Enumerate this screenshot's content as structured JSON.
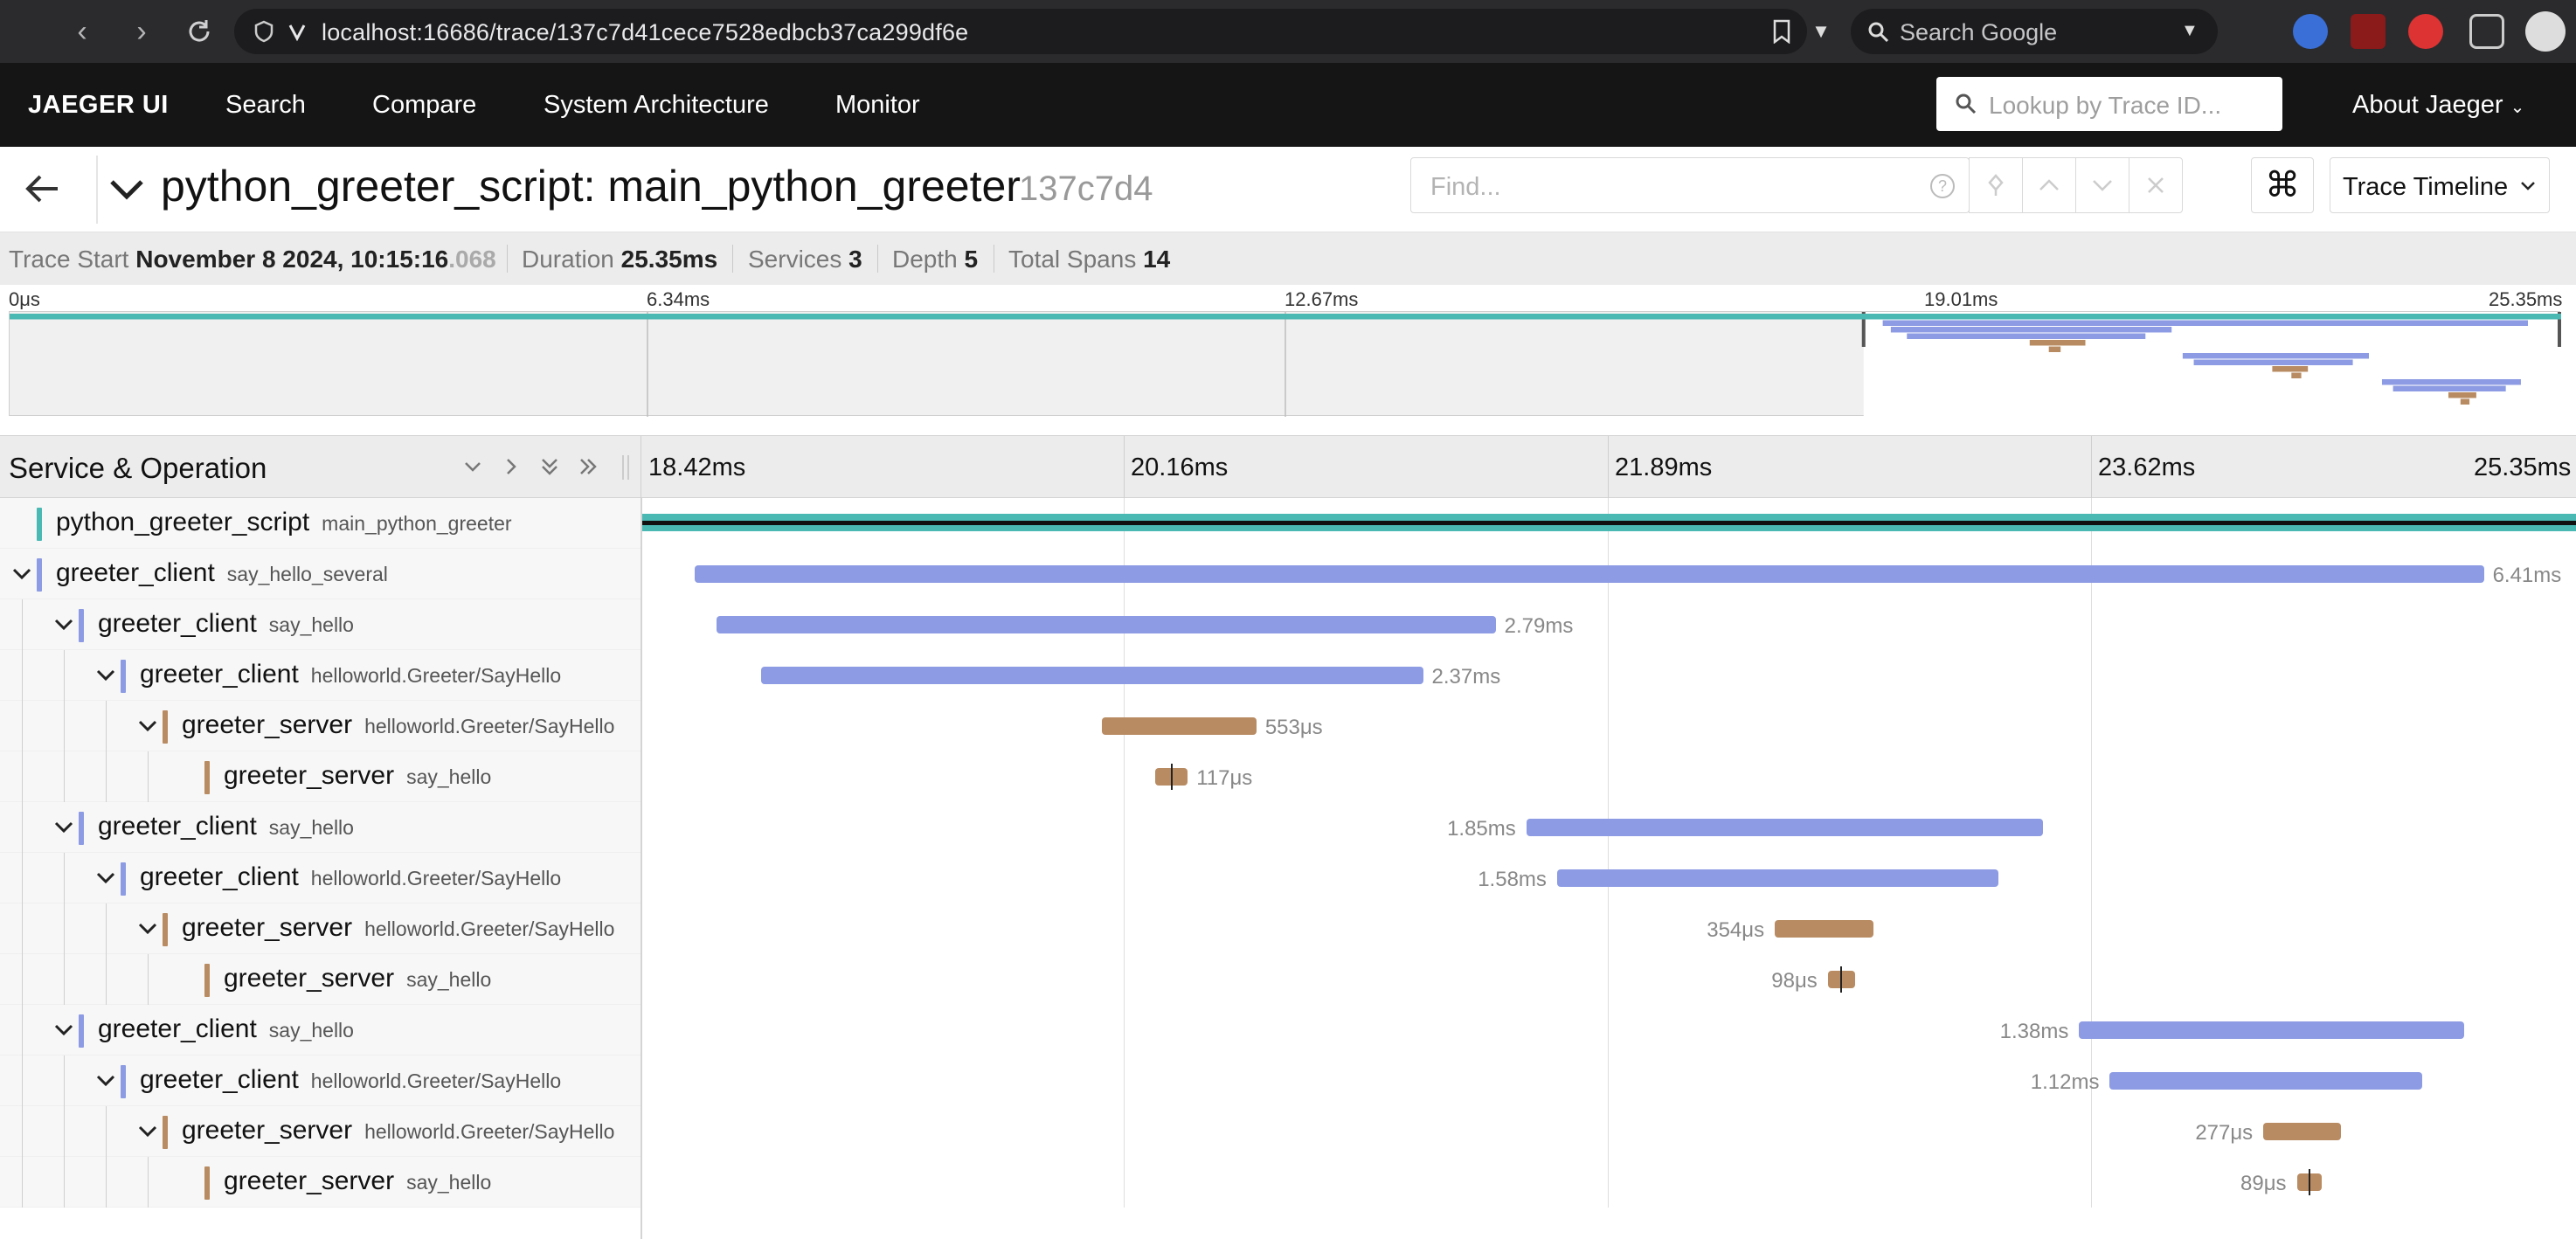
{
  "browser": {
    "url": "localhost:16686/trace/137c7d41cece7528edbcb37ca299df6e",
    "search_placeholder": "Search Google"
  },
  "topnav": {
    "brand": "JAEGER UI",
    "items": [
      "Search",
      "Compare",
      "System Architecture",
      "Monitor"
    ],
    "lookup_placeholder": "Lookup by Trace ID...",
    "about": "About Jaeger"
  },
  "trace": {
    "title": "python_greeter_script: main_python_greeter",
    "short_id": "137c7d4",
    "find_placeholder": "Find...",
    "view_mode": "Trace Timeline"
  },
  "summary": {
    "trace_start_label": "Trace Start",
    "trace_start_value": "November 8 2024, 10:15:16",
    "trace_start_ms": ".068",
    "duration_label": "Duration",
    "duration_value": "25.35ms",
    "services_label": "Services",
    "services_value": "3",
    "depth_label": "Depth",
    "depth_value": "5",
    "total_spans_label": "Total Spans",
    "total_spans_value": "14"
  },
  "minimap": {
    "ticks": [
      "0μs",
      "6.34ms",
      "12.67ms",
      "19.01ms",
      "25.35ms"
    ]
  },
  "timeline": {
    "header_title": "Service & Operation",
    "ticks": [
      "18.42ms",
      "20.16ms",
      "21.89ms",
      "23.62ms",
      "25.35ms"
    ]
  },
  "colors": {
    "python_greeter_script": "#4ab8b3",
    "greeter_client": "#8c9be3",
    "greeter_server": "#b88b62"
  },
  "spans": [
    {
      "service": "python_greeter_script",
      "operation": "main_python_greeter",
      "depth": 0,
      "has_children": false,
      "start_ms": 0.0,
      "duration_ms": 25.35,
      "label": ""
    },
    {
      "service": "greeter_client",
      "operation": "say_hello_several",
      "depth": 0,
      "has_children": true,
      "start_ms": 18.61,
      "duration_ms": 6.41,
      "label": "6.41ms"
    },
    {
      "service": "greeter_client",
      "operation": "say_hello",
      "depth": 1,
      "has_children": true,
      "start_ms": 18.69,
      "duration_ms": 2.79,
      "label": "2.79ms"
    },
    {
      "service": "greeter_client",
      "operation": "helloworld.Greeter/SayHello",
      "depth": 2,
      "has_children": true,
      "start_ms": 18.85,
      "duration_ms": 2.37,
      "label": "2.37ms"
    },
    {
      "service": "greeter_server",
      "operation": "helloworld.Greeter/SayHello",
      "depth": 3,
      "has_children": true,
      "start_ms": 20.07,
      "duration_ms": 0.553,
      "label": "553μs"
    },
    {
      "service": "greeter_server",
      "operation": "say_hello",
      "depth": 4,
      "has_children": false,
      "start_ms": 20.26,
      "duration_ms": 0.117,
      "label": "117μs"
    },
    {
      "service": "greeter_client",
      "operation": "say_hello",
      "depth": 1,
      "has_children": true,
      "start_ms": 21.59,
      "duration_ms": 1.85,
      "label": "1.85ms"
    },
    {
      "service": "greeter_client",
      "operation": "helloworld.Greeter/SayHello",
      "depth": 2,
      "has_children": true,
      "start_ms": 21.7,
      "duration_ms": 1.58,
      "label": "1.58ms"
    },
    {
      "service": "greeter_server",
      "operation": "helloworld.Greeter/SayHello",
      "depth": 3,
      "has_children": true,
      "start_ms": 22.48,
      "duration_ms": 0.354,
      "label": "354μs"
    },
    {
      "service": "greeter_server",
      "operation": "say_hello",
      "depth": 4,
      "has_children": false,
      "start_ms": 22.67,
      "duration_ms": 0.098,
      "label": "98μs"
    },
    {
      "service": "greeter_client",
      "operation": "say_hello",
      "depth": 1,
      "has_children": true,
      "start_ms": 23.57,
      "duration_ms": 1.38,
      "label": "1.38ms"
    },
    {
      "service": "greeter_client",
      "operation": "helloworld.Greeter/SayHello",
      "depth": 2,
      "has_children": true,
      "start_ms": 23.68,
      "duration_ms": 1.12,
      "label": "1.12ms"
    },
    {
      "service": "greeter_server",
      "operation": "helloworld.Greeter/SayHello",
      "depth": 3,
      "has_children": true,
      "start_ms": 24.23,
      "duration_ms": 0.277,
      "label": "277μs"
    },
    {
      "service": "greeter_server",
      "operation": "say_hello",
      "depth": 4,
      "has_children": false,
      "start_ms": 24.35,
      "duration_ms": 0.089,
      "label": "89μs"
    }
  ]
}
